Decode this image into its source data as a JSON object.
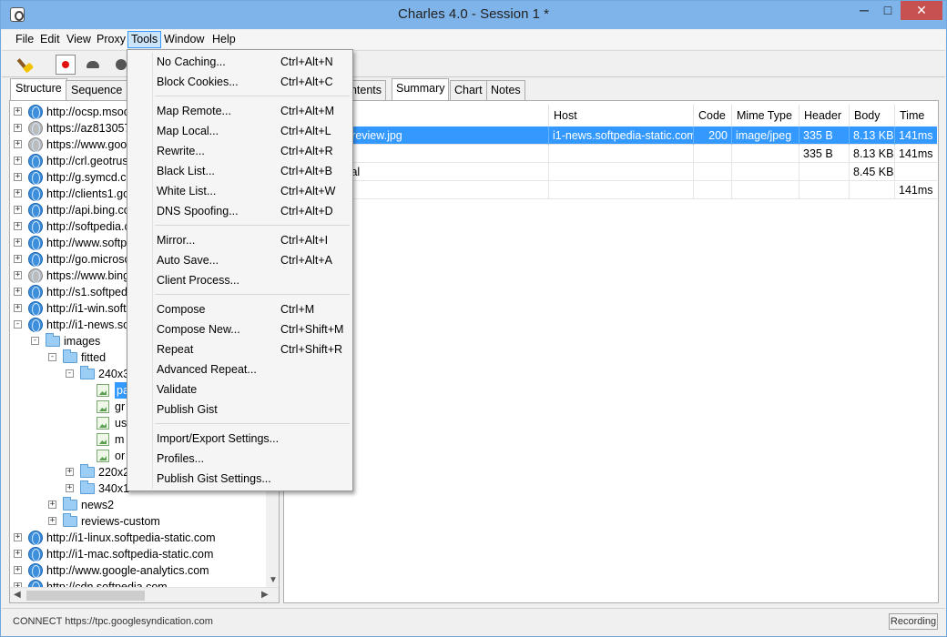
{
  "window": {
    "title": "Charles 4.0 - Session 1 *",
    "minimize": "─",
    "maximize": "□",
    "close": "✕"
  },
  "menubar": [
    "File",
    "Edit",
    "View",
    "Proxy",
    "Tools",
    "Window",
    "Help"
  ],
  "menubar_active": "Tools",
  "toolbar": {
    "icons": [
      "broom-icon",
      "record-icon",
      "throttle-turtle-icon",
      "breakpoint-icon"
    ]
  },
  "left_tabs": [
    "Structure",
    "Sequence"
  ],
  "left_tab_selected": "Structure",
  "tree": [
    {
      "label": "http://ocsp.msocsp.com",
      "depth": 0,
      "icon": "globe",
      "expander": "+"
    },
    {
      "label": "https://az813057.vo.msecnd.net",
      "depth": 0,
      "icon": "lock",
      "expander": "+"
    },
    {
      "label": "https://www.google.com",
      "depth": 0,
      "icon": "lock",
      "expander": "+"
    },
    {
      "label": "http://crl.geotrust.com",
      "depth": 0,
      "icon": "globe",
      "expander": "+"
    },
    {
      "label": "http://g.symcd.com",
      "depth": 0,
      "icon": "globe",
      "expander": "+"
    },
    {
      "label": "http://clients1.google.com",
      "depth": 0,
      "icon": "globe",
      "expander": "+"
    },
    {
      "label": "http://api.bing.com",
      "depth": 0,
      "icon": "globe",
      "expander": "+"
    },
    {
      "label": "http://softpedia.com",
      "depth": 0,
      "icon": "globe",
      "expander": "+"
    },
    {
      "label": "http://www.softpedia.com",
      "depth": 0,
      "icon": "globe",
      "expander": "+"
    },
    {
      "label": "http://go.microsoft.com",
      "depth": 0,
      "icon": "globe",
      "expander": "+"
    },
    {
      "label": "https://www.bing.com",
      "depth": 0,
      "icon": "lock",
      "expander": "+"
    },
    {
      "label": "http://s1.softpedia-static.com",
      "depth": 0,
      "icon": "globe",
      "expander": "+"
    },
    {
      "label": "http://i1-win.softpedia-static.com",
      "depth": 0,
      "icon": "globe",
      "expander": "+"
    },
    {
      "label": "http://i1-news.softpedia-static.com",
      "depth": 0,
      "icon": "globe",
      "expander": "-"
    },
    {
      "label": "images",
      "depth": 1,
      "icon": "folder",
      "expander": "-"
    },
    {
      "label": "fitted",
      "depth": 2,
      "icon": "folder",
      "expander": "-"
    },
    {
      "label": "240x300",
      "depth": 3,
      "icon": "folder",
      "expander": "-"
    },
    {
      "label": "pa",
      "depth": 4,
      "icon": "image",
      "expander": "",
      "selected": true
    },
    {
      "label": "gr",
      "depth": 4,
      "icon": "image",
      "expander": ""
    },
    {
      "label": "us",
      "depth": 4,
      "icon": "image",
      "expander": ""
    },
    {
      "label": "m",
      "depth": 4,
      "icon": "image",
      "expander": ""
    },
    {
      "label": "or",
      "depth": 4,
      "icon": "image",
      "expander": ""
    },
    {
      "label": "220x2",
      "depth": 3,
      "icon": "folder",
      "expander": "+"
    },
    {
      "label": "340x1",
      "depth": 3,
      "icon": "folder",
      "expander": "+"
    },
    {
      "label": "news2",
      "depth": 2,
      "icon": "folder",
      "expander": "+"
    },
    {
      "label": "reviews-custom",
      "depth": 2,
      "icon": "folder",
      "expander": "+"
    },
    {
      "label": "http://i1-linux.softpedia-static.com",
      "depth": 0,
      "icon": "globe",
      "expander": "+"
    },
    {
      "label": "http://i1-mac.softpedia-static.com",
      "depth": 0,
      "icon": "globe",
      "expander": "+"
    },
    {
      "label": "http://www.google-analytics.com",
      "depth": 0,
      "icon": "globe",
      "expander": "+"
    },
    {
      "label": "http://cdn.softpedia.com",
      "depth": 0,
      "icon": "globe",
      "expander": "+"
    }
  ],
  "right_tabs": [
    "Contents",
    "Summary",
    "Chart",
    "Notes"
  ],
  "right_tab_selected": "Summary",
  "table": {
    "headers": [
      "Host",
      "Code",
      "Mime Type",
      "Header",
      "Body",
      "Time"
    ],
    "rows": [
      {
        "name": "-review.jpg",
        "host": "i1-news.softpedia-static.com",
        "code": "200",
        "mime": "image/jpeg",
        "header": "335 B",
        "body": "8.13 KB",
        "time": "141ms",
        "selected": true
      },
      {
        "name": "",
        "host": "",
        "code": "",
        "mime": "",
        "header": "335 B",
        "body": "8.13 KB",
        "time": "141ms"
      },
      {
        "name": "tal",
        "host": "",
        "code": "",
        "mime": "",
        "header": "",
        "body": "8.45 KB",
        "time": ""
      },
      {
        "name": "",
        "host": "",
        "code": "",
        "mime": "",
        "header": "",
        "body": "",
        "time": "141ms"
      }
    ]
  },
  "tools_menu": [
    {
      "label": "No Caching...",
      "shortcut": "Ctrl+Alt+N"
    },
    {
      "label": "Block Cookies...",
      "shortcut": "Ctrl+Alt+C"
    },
    {
      "separator": true
    },
    {
      "label": "Map Remote...",
      "shortcut": "Ctrl+Alt+M"
    },
    {
      "label": "Map Local...",
      "shortcut": "Ctrl+Alt+L"
    },
    {
      "label": "Rewrite...",
      "shortcut": "Ctrl+Alt+R"
    },
    {
      "label": "Black List...",
      "shortcut": "Ctrl+Alt+B"
    },
    {
      "label": "White List...",
      "shortcut": "Ctrl+Alt+W"
    },
    {
      "label": "DNS Spoofing...",
      "shortcut": "Ctrl+Alt+D"
    },
    {
      "separator": true
    },
    {
      "label": "Mirror...",
      "shortcut": "Ctrl+Alt+I"
    },
    {
      "label": "Auto Save...",
      "shortcut": "Ctrl+Alt+A"
    },
    {
      "label": "Client Process...",
      "shortcut": ""
    },
    {
      "separator": true
    },
    {
      "label": "Compose",
      "shortcut": "Ctrl+M"
    },
    {
      "label": "Compose New...",
      "shortcut": "Ctrl+Shift+M"
    },
    {
      "label": "Repeat",
      "shortcut": "Ctrl+Shift+R"
    },
    {
      "label": "Advanced Repeat...",
      "shortcut": ""
    },
    {
      "label": "Validate",
      "shortcut": ""
    },
    {
      "label": "Publish Gist",
      "shortcut": ""
    },
    {
      "separator": true
    },
    {
      "label": "Import/Export Settings...",
      "shortcut": ""
    },
    {
      "label": "Profiles...",
      "shortcut": ""
    },
    {
      "label": "Publish Gist Settings...",
      "shortcut": ""
    }
  ],
  "status": {
    "message": "CONNECT https://tpc.googlesyndication.com",
    "recording": "Recording"
  },
  "colors": {
    "titlebar": "#7eb4ea",
    "selection": "#3399ff",
    "close_button": "#c75050"
  }
}
